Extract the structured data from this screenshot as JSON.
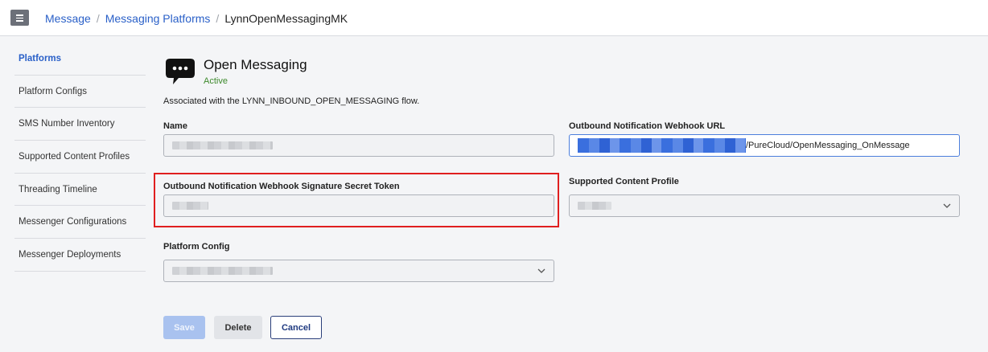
{
  "breadcrumb": {
    "items": [
      "Message",
      "Messaging Platforms"
    ],
    "separator": "/",
    "current": "LynnOpenMessagingMK"
  },
  "sidebar": {
    "items": [
      {
        "label": "Platforms",
        "active": true
      },
      {
        "label": "Platform Configs"
      },
      {
        "label": "SMS Number Inventory"
      },
      {
        "label": "Supported Content Profiles"
      },
      {
        "label": "Threading Timeline"
      },
      {
        "label": "Messenger Configurations"
      },
      {
        "label": "Messenger Deployments"
      }
    ]
  },
  "platform": {
    "title": "Open Messaging",
    "status": "Active",
    "association": "Associated with the LYNN_INBOUND_OPEN_MESSAGING flow.",
    "icon": "chat-bubble-icon"
  },
  "form": {
    "name_label": "Name",
    "webhook_url_label": "Outbound Notification Webhook URL",
    "webhook_url_visible_suffix": "/PureCloud/OpenMessaging_OnMessage",
    "secret_token_label": "Outbound Notification Webhook Signature Secret Token",
    "content_profile_label": "Supported Content Profile",
    "platform_config_label": "Platform Config"
  },
  "buttons": {
    "save": "Save",
    "delete": "Delete",
    "cancel": "Cancel"
  },
  "colors": {
    "link": "#2a60c8",
    "active_status": "#3d8a2c",
    "highlight": "#e01f1f",
    "save_disabled": "#a9c2ef"
  }
}
